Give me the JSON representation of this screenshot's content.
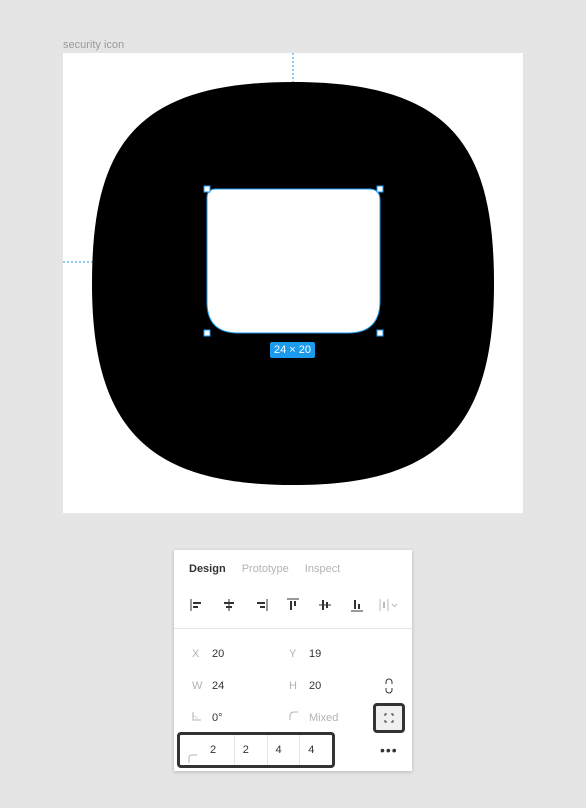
{
  "canvas": {
    "frame_label": "security icon",
    "selection_size": "24 × 20",
    "accent_color": "#1b9aee"
  },
  "panel": {
    "tabs": [
      {
        "label": "Design",
        "active": true
      },
      {
        "label": "Prototype",
        "active": false
      },
      {
        "label": "Inspect",
        "active": false
      }
    ],
    "align_icons": [
      "align-left-icon",
      "align-horizontal-center-icon",
      "align-right-icon",
      "align-top-icon",
      "align-vertical-center-icon",
      "align-bottom-icon",
      "distribute-icon"
    ],
    "x": {
      "label": "X",
      "value": "20"
    },
    "y": {
      "label": "Y",
      "value": "19"
    },
    "w": {
      "label": "W",
      "value": "24"
    },
    "h": {
      "label": "H",
      "value": "20"
    },
    "rotation": {
      "value": "0°"
    },
    "corner_radius": {
      "value": "Mixed"
    },
    "radii": [
      "2",
      "2",
      "4",
      "4"
    ]
  }
}
